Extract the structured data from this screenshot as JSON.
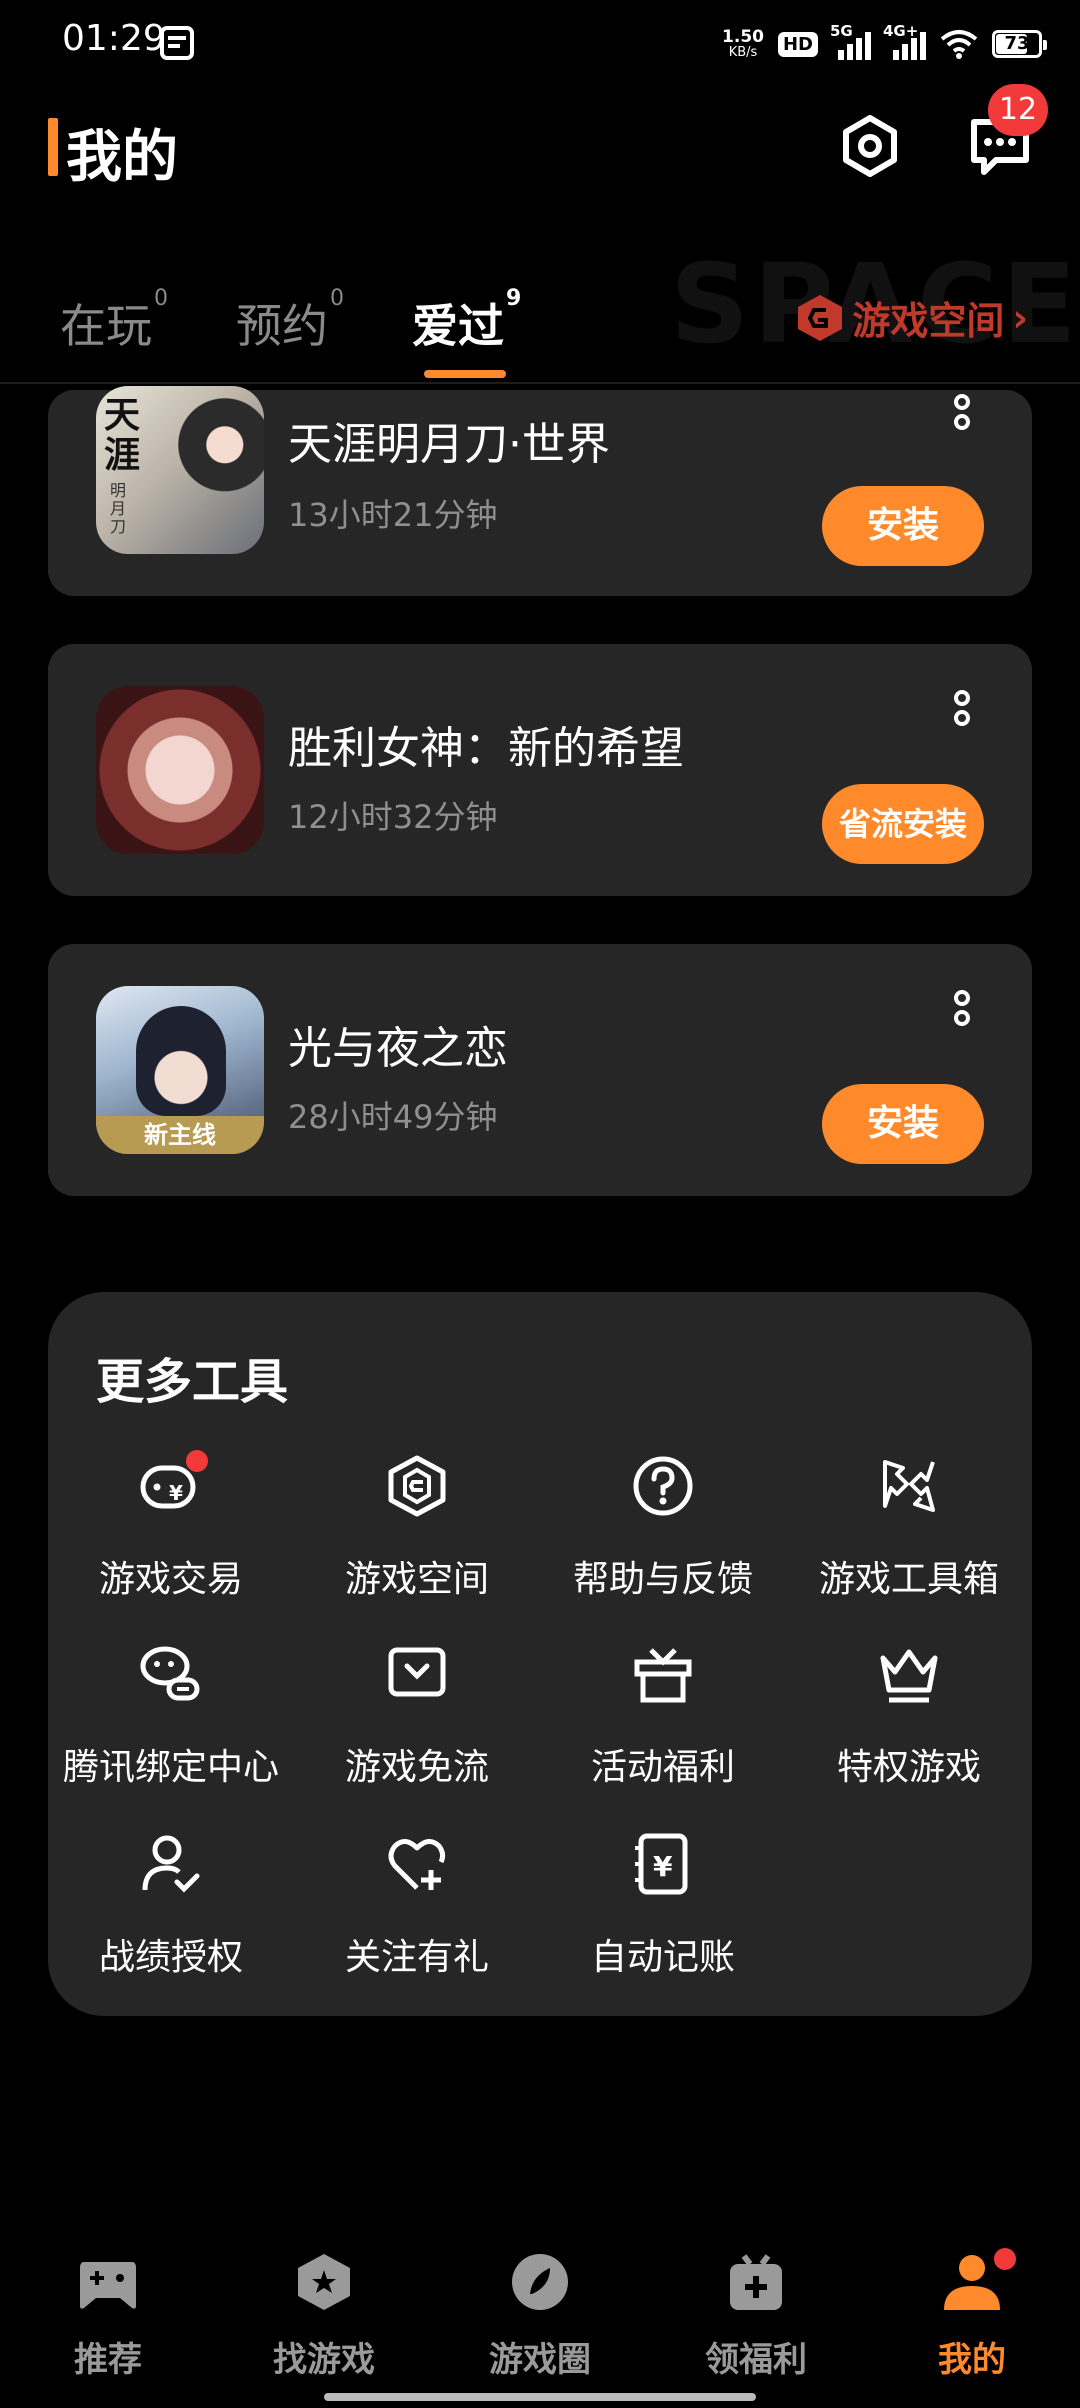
{
  "status_bar": {
    "time": "01:29",
    "net_speed_value": "1.50",
    "net_speed_unit": "KB/s",
    "hd": "HD",
    "sim2_label": "5G",
    "sim1_label": "4G+",
    "battery": "73"
  },
  "header": {
    "title": "我的",
    "message_badge": "12",
    "icons": [
      "settings-icon",
      "message-icon"
    ]
  },
  "tabs": [
    {
      "label": "在玩",
      "count": "0"
    },
    {
      "label": "预约",
      "count": "0"
    },
    {
      "label": "爱过",
      "count": "9",
      "active": true
    }
  ],
  "space_link": {
    "label": "游戏空间",
    "watermark": "SPACE"
  },
  "games": [
    {
      "name": "天涯明月刀·世界",
      "time": "13小时21分钟",
      "action": "安装"
    },
    {
      "name": "胜利女神：新的希望",
      "time": "12小时32分钟",
      "action": "省流安装"
    },
    {
      "name": "光与夜之恋",
      "time": "28小时49分钟",
      "action": "安装",
      "icon_banner": "新主线"
    }
  ],
  "game1_icon_text": {
    "main": "天涯",
    "sub": "明月刀"
  },
  "tools": {
    "title": "更多工具",
    "items": [
      {
        "label": "游戏交易",
        "icon": "trade-icon",
        "dot": true
      },
      {
        "label": "游戏空间",
        "icon": "space-icon"
      },
      {
        "label": "帮助与反馈",
        "icon": "help-icon"
      },
      {
        "label": "游戏工具箱",
        "icon": "toolbox-icon"
      },
      {
        "label": "腾讯绑定中心",
        "icon": "wechat-bind-icon"
      },
      {
        "label": "游戏免流",
        "icon": "data-free-icon"
      },
      {
        "label": "活动福利",
        "icon": "gift-icon"
      },
      {
        "label": "特权游戏",
        "icon": "crown-icon"
      },
      {
        "label": "战绩授权",
        "icon": "user-check-icon"
      },
      {
        "label": "关注有礼",
        "icon": "heart-plus-icon"
      },
      {
        "label": "自动记账",
        "icon": "ledger-icon"
      }
    ]
  },
  "bottom_nav": [
    {
      "label": "推荐",
      "icon": "gamepad-icon"
    },
    {
      "label": "找游戏",
      "icon": "star-hex-icon"
    },
    {
      "label": "游戏圈",
      "icon": "leaf-icon"
    },
    {
      "label": "领福利",
      "icon": "gift-box-icon"
    },
    {
      "label": "我的",
      "icon": "profile-icon",
      "active": true,
      "dot": true
    }
  ],
  "colors": {
    "accent": "#ff8a2b",
    "card": "#262626",
    "badge": "#f23a3a",
    "space_red": "#c0392b"
  }
}
